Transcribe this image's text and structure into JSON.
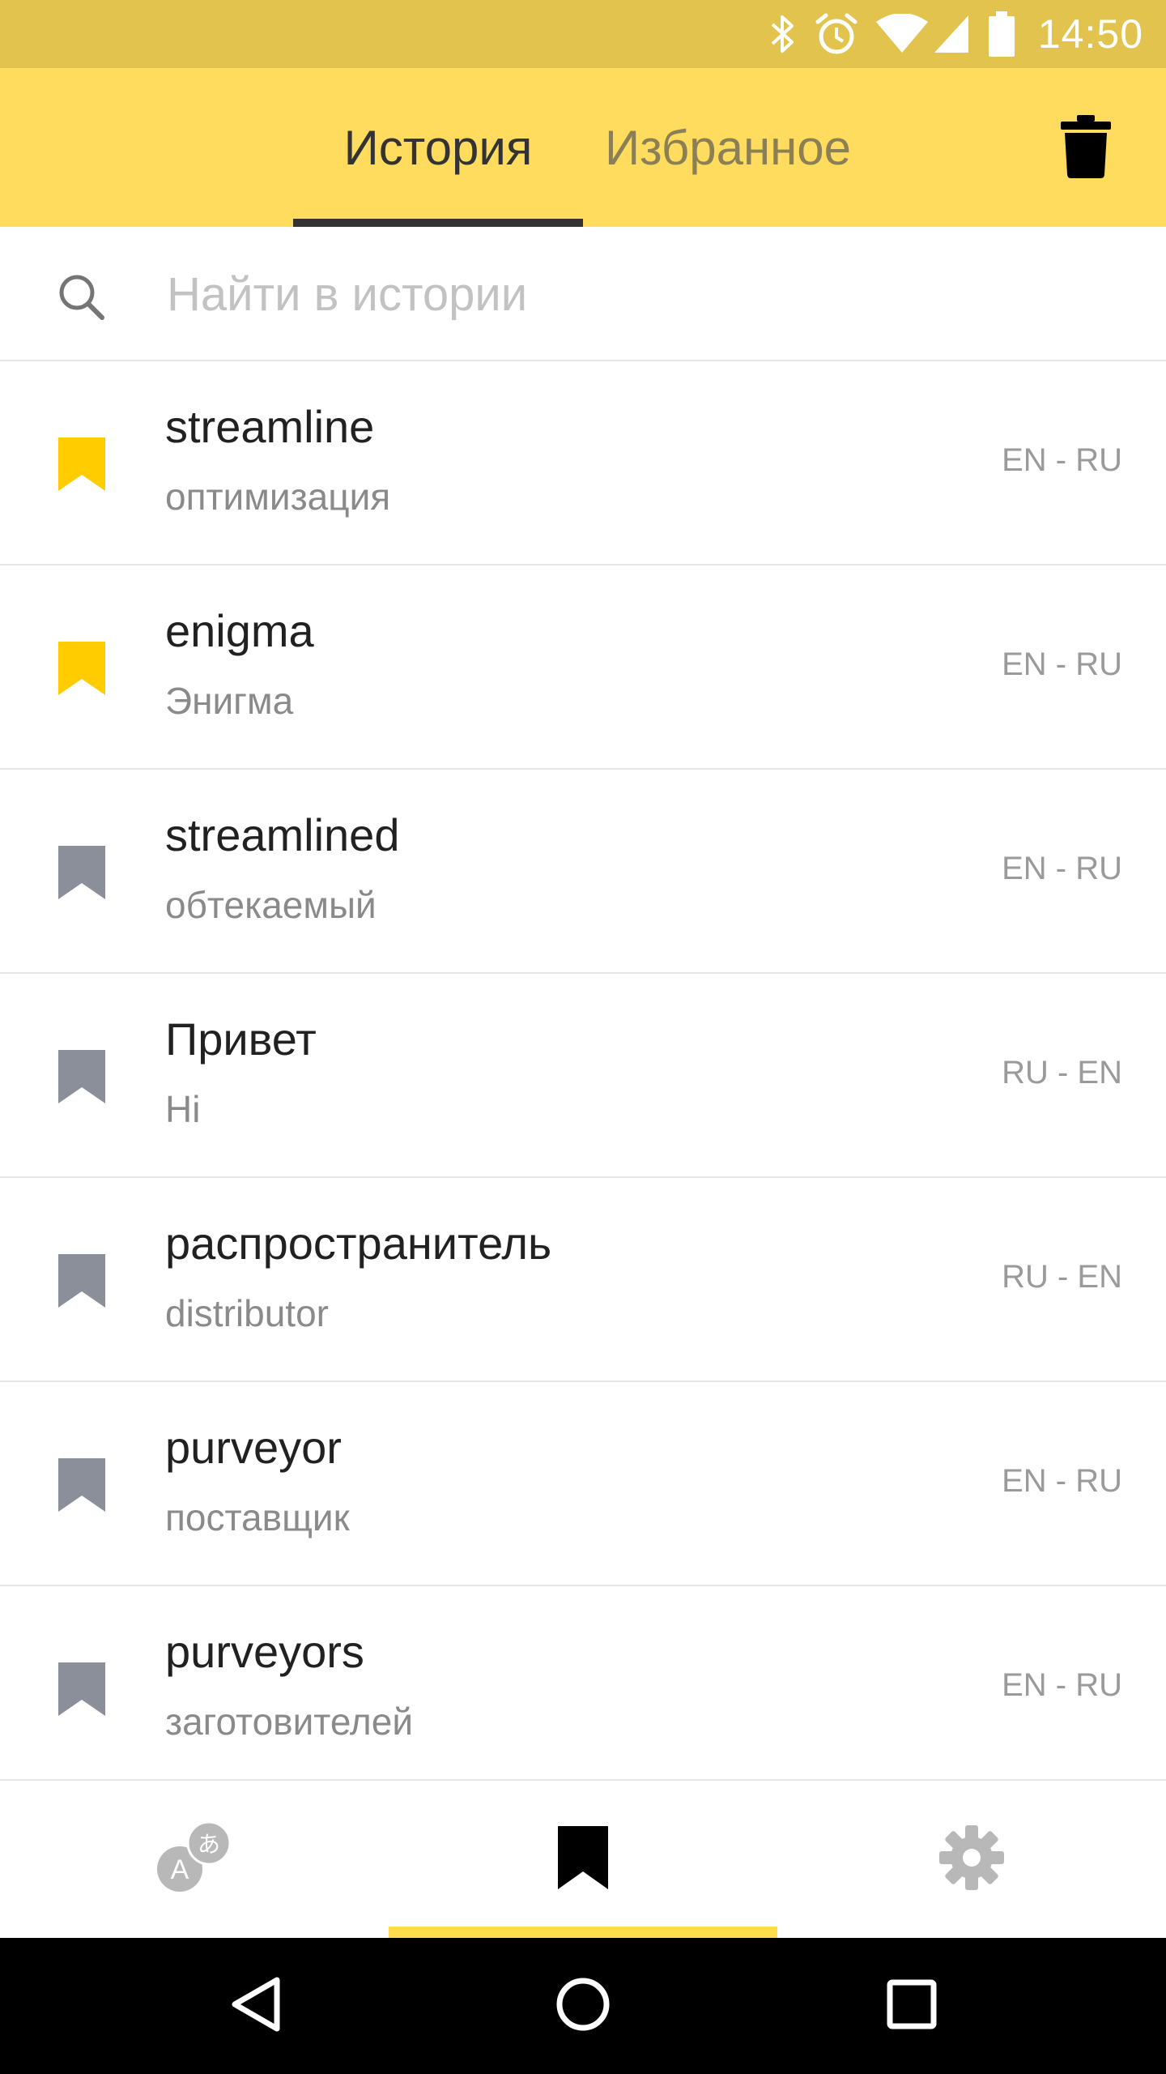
{
  "status_bar": {
    "time": "14:50",
    "icons": [
      "bluetooth-icon",
      "alarm-icon",
      "wifi-icon",
      "signal-icon",
      "battery-icon"
    ]
  },
  "tabs": [
    {
      "label": "История",
      "active": true
    },
    {
      "label": "Избранное",
      "active": false
    }
  ],
  "header": {
    "trash_icon": "trash-icon"
  },
  "search": {
    "placeholder": "Найти в истории",
    "value": ""
  },
  "colors": {
    "header": "#ffdb5e",
    "status_bar": "#e2c34e",
    "bookmark_active": "#ffcc00",
    "bookmark_inactive": "#8a8f99",
    "nav_indicator": "#ffdb4d"
  },
  "history": [
    {
      "word": "streamline",
      "translation": "оптимизация",
      "lang": "EN - RU",
      "favorite": true
    },
    {
      "word": "enigma",
      "translation": "Энигма",
      "lang": "EN - RU",
      "favorite": true
    },
    {
      "word": "streamlined",
      "translation": "обтекаемый",
      "lang": "EN - RU",
      "favorite": false
    },
    {
      "word": "Привет",
      "translation": "Hi",
      "lang": "RU - EN",
      "favorite": false
    },
    {
      "word": "распространитель",
      "translation": "distributor",
      "lang": "RU - EN",
      "favorite": false
    },
    {
      "word": "purveyor",
      "translation": "поставщик",
      "lang": "EN - RU",
      "favorite": false
    },
    {
      "word": "purveyors",
      "translation": "заготовителей",
      "lang": "EN - RU",
      "favorite": false
    }
  ],
  "bottom_nav": [
    {
      "icon": "translate-icon",
      "active": false
    },
    {
      "icon": "bookmark-icon",
      "active": true
    },
    {
      "icon": "gear-icon",
      "active": false
    }
  ],
  "system_nav": [
    "back-icon",
    "home-icon",
    "recents-icon"
  ]
}
